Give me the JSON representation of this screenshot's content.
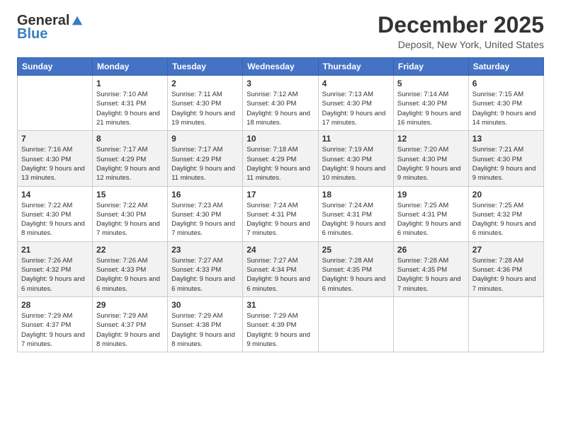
{
  "logo": {
    "general": "General",
    "blue": "Blue"
  },
  "header": {
    "title": "December 2025",
    "subtitle": "Deposit, New York, United States"
  },
  "weekdays": [
    "Sunday",
    "Monday",
    "Tuesday",
    "Wednesday",
    "Thursday",
    "Friday",
    "Saturday"
  ],
  "weeks": [
    [
      {
        "day": "",
        "info": ""
      },
      {
        "day": "1",
        "info": "Sunrise: 7:10 AM\nSunset: 4:31 PM\nDaylight: 9 hours\nand 21 minutes."
      },
      {
        "day": "2",
        "info": "Sunrise: 7:11 AM\nSunset: 4:30 PM\nDaylight: 9 hours\nand 19 minutes."
      },
      {
        "day": "3",
        "info": "Sunrise: 7:12 AM\nSunset: 4:30 PM\nDaylight: 9 hours\nand 18 minutes."
      },
      {
        "day": "4",
        "info": "Sunrise: 7:13 AM\nSunset: 4:30 PM\nDaylight: 9 hours\nand 17 minutes."
      },
      {
        "day": "5",
        "info": "Sunrise: 7:14 AM\nSunset: 4:30 PM\nDaylight: 9 hours\nand 16 minutes."
      },
      {
        "day": "6",
        "info": "Sunrise: 7:15 AM\nSunset: 4:30 PM\nDaylight: 9 hours\nand 14 minutes."
      }
    ],
    [
      {
        "day": "7",
        "info": "Sunrise: 7:16 AM\nSunset: 4:30 PM\nDaylight: 9 hours\nand 13 minutes."
      },
      {
        "day": "8",
        "info": "Sunrise: 7:17 AM\nSunset: 4:29 PM\nDaylight: 9 hours\nand 12 minutes."
      },
      {
        "day": "9",
        "info": "Sunrise: 7:17 AM\nSunset: 4:29 PM\nDaylight: 9 hours\nand 11 minutes."
      },
      {
        "day": "10",
        "info": "Sunrise: 7:18 AM\nSunset: 4:29 PM\nDaylight: 9 hours\nand 11 minutes."
      },
      {
        "day": "11",
        "info": "Sunrise: 7:19 AM\nSunset: 4:30 PM\nDaylight: 9 hours\nand 10 minutes."
      },
      {
        "day": "12",
        "info": "Sunrise: 7:20 AM\nSunset: 4:30 PM\nDaylight: 9 hours\nand 9 minutes."
      },
      {
        "day": "13",
        "info": "Sunrise: 7:21 AM\nSunset: 4:30 PM\nDaylight: 9 hours\nand 9 minutes."
      }
    ],
    [
      {
        "day": "14",
        "info": "Sunrise: 7:22 AM\nSunset: 4:30 PM\nDaylight: 9 hours\nand 8 minutes."
      },
      {
        "day": "15",
        "info": "Sunrise: 7:22 AM\nSunset: 4:30 PM\nDaylight: 9 hours\nand 7 minutes."
      },
      {
        "day": "16",
        "info": "Sunrise: 7:23 AM\nSunset: 4:30 PM\nDaylight: 9 hours\nand 7 minutes."
      },
      {
        "day": "17",
        "info": "Sunrise: 7:24 AM\nSunset: 4:31 PM\nDaylight: 9 hours\nand 7 minutes."
      },
      {
        "day": "18",
        "info": "Sunrise: 7:24 AM\nSunset: 4:31 PM\nDaylight: 9 hours\nand 6 minutes."
      },
      {
        "day": "19",
        "info": "Sunrise: 7:25 AM\nSunset: 4:31 PM\nDaylight: 9 hours\nand 6 minutes."
      },
      {
        "day": "20",
        "info": "Sunrise: 7:25 AM\nSunset: 4:32 PM\nDaylight: 9 hours\nand 6 minutes."
      }
    ],
    [
      {
        "day": "21",
        "info": "Sunrise: 7:26 AM\nSunset: 4:32 PM\nDaylight: 9 hours\nand 6 minutes."
      },
      {
        "day": "22",
        "info": "Sunrise: 7:26 AM\nSunset: 4:33 PM\nDaylight: 9 hours\nand 6 minutes."
      },
      {
        "day": "23",
        "info": "Sunrise: 7:27 AM\nSunset: 4:33 PM\nDaylight: 9 hours\nand 6 minutes."
      },
      {
        "day": "24",
        "info": "Sunrise: 7:27 AM\nSunset: 4:34 PM\nDaylight: 9 hours\nand 6 minutes."
      },
      {
        "day": "25",
        "info": "Sunrise: 7:28 AM\nSunset: 4:35 PM\nDaylight: 9 hours\nand 6 minutes."
      },
      {
        "day": "26",
        "info": "Sunrise: 7:28 AM\nSunset: 4:35 PM\nDaylight: 9 hours\nand 7 minutes."
      },
      {
        "day": "27",
        "info": "Sunrise: 7:28 AM\nSunset: 4:36 PM\nDaylight: 9 hours\nand 7 minutes."
      }
    ],
    [
      {
        "day": "28",
        "info": "Sunrise: 7:29 AM\nSunset: 4:37 PM\nDaylight: 9 hours\nand 7 minutes."
      },
      {
        "day": "29",
        "info": "Sunrise: 7:29 AM\nSunset: 4:37 PM\nDaylight: 9 hours\nand 8 minutes."
      },
      {
        "day": "30",
        "info": "Sunrise: 7:29 AM\nSunset: 4:38 PM\nDaylight: 9 hours\nand 8 minutes."
      },
      {
        "day": "31",
        "info": "Sunrise: 7:29 AM\nSunset: 4:39 PM\nDaylight: 9 hours\nand 9 minutes."
      },
      {
        "day": "",
        "info": ""
      },
      {
        "day": "",
        "info": ""
      },
      {
        "day": "",
        "info": ""
      }
    ]
  ]
}
